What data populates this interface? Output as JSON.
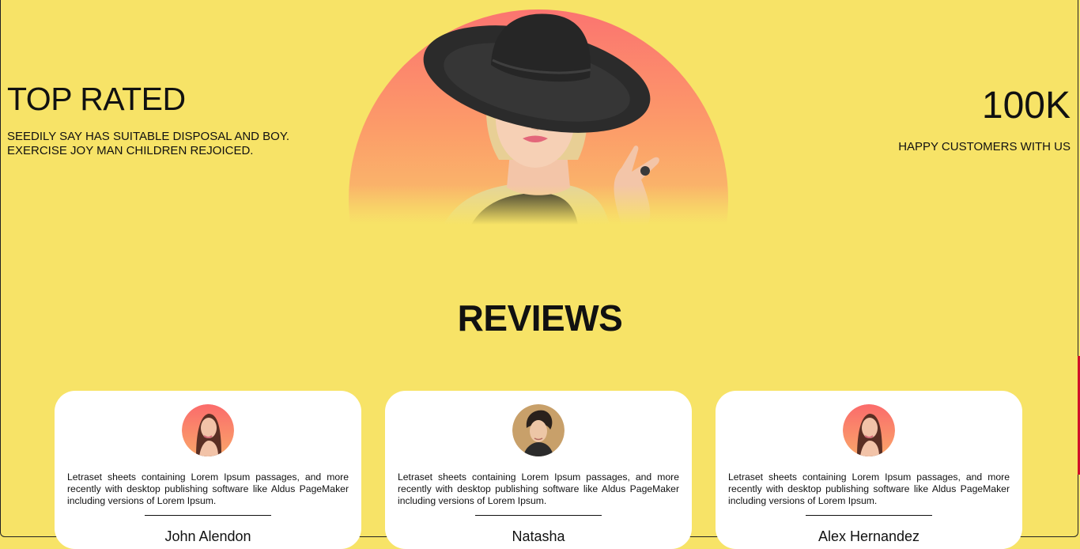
{
  "hero": {
    "left": {
      "title": "TOP RATED",
      "lines": [
        "SEEDILY SAY HAS SUITABLE DISPOSAL AND BOY.",
        "EXERCISE JOY MAN CHILDREN REJOICED."
      ]
    },
    "right": {
      "value": "100K",
      "caption": "HAPPY CUSTOMERS WITH US"
    }
  },
  "reviews": {
    "title": "REVIEWS",
    "items": [
      {
        "text": "Letraset sheets containing Lorem Ipsum passages, and more recently with desktop publishing software like Aldus PageMaker including versions of Lorem Ipsum.",
        "name": "John Alendon"
      },
      {
        "text": "Letraset sheets containing Lorem Ipsum passages, and more recently with desktop publishing software like Aldus PageMaker including versions of Lorem Ipsum.",
        "name": "Natasha"
      },
      {
        "text": "Letraset sheets containing Lorem Ipsum passages, and more recently with desktop publishing software like Aldus PageMaker including versions of Lorem Ipsum.",
        "name": "Alex Hernandez"
      }
    ]
  },
  "colors": {
    "background": "#f7e367",
    "card": "#ffffff",
    "accent_gradient_top": "#fb7470",
    "accent_gradient_bottom": "#f9bf6a",
    "scroll_indicator": "#d0102a"
  },
  "icons": {
    "hero_image": "woman-in-black-hat-portrait",
    "avatar_1": "woman-avatar",
    "avatar_2": "man-avatar",
    "avatar_3": "woman-avatar"
  }
}
